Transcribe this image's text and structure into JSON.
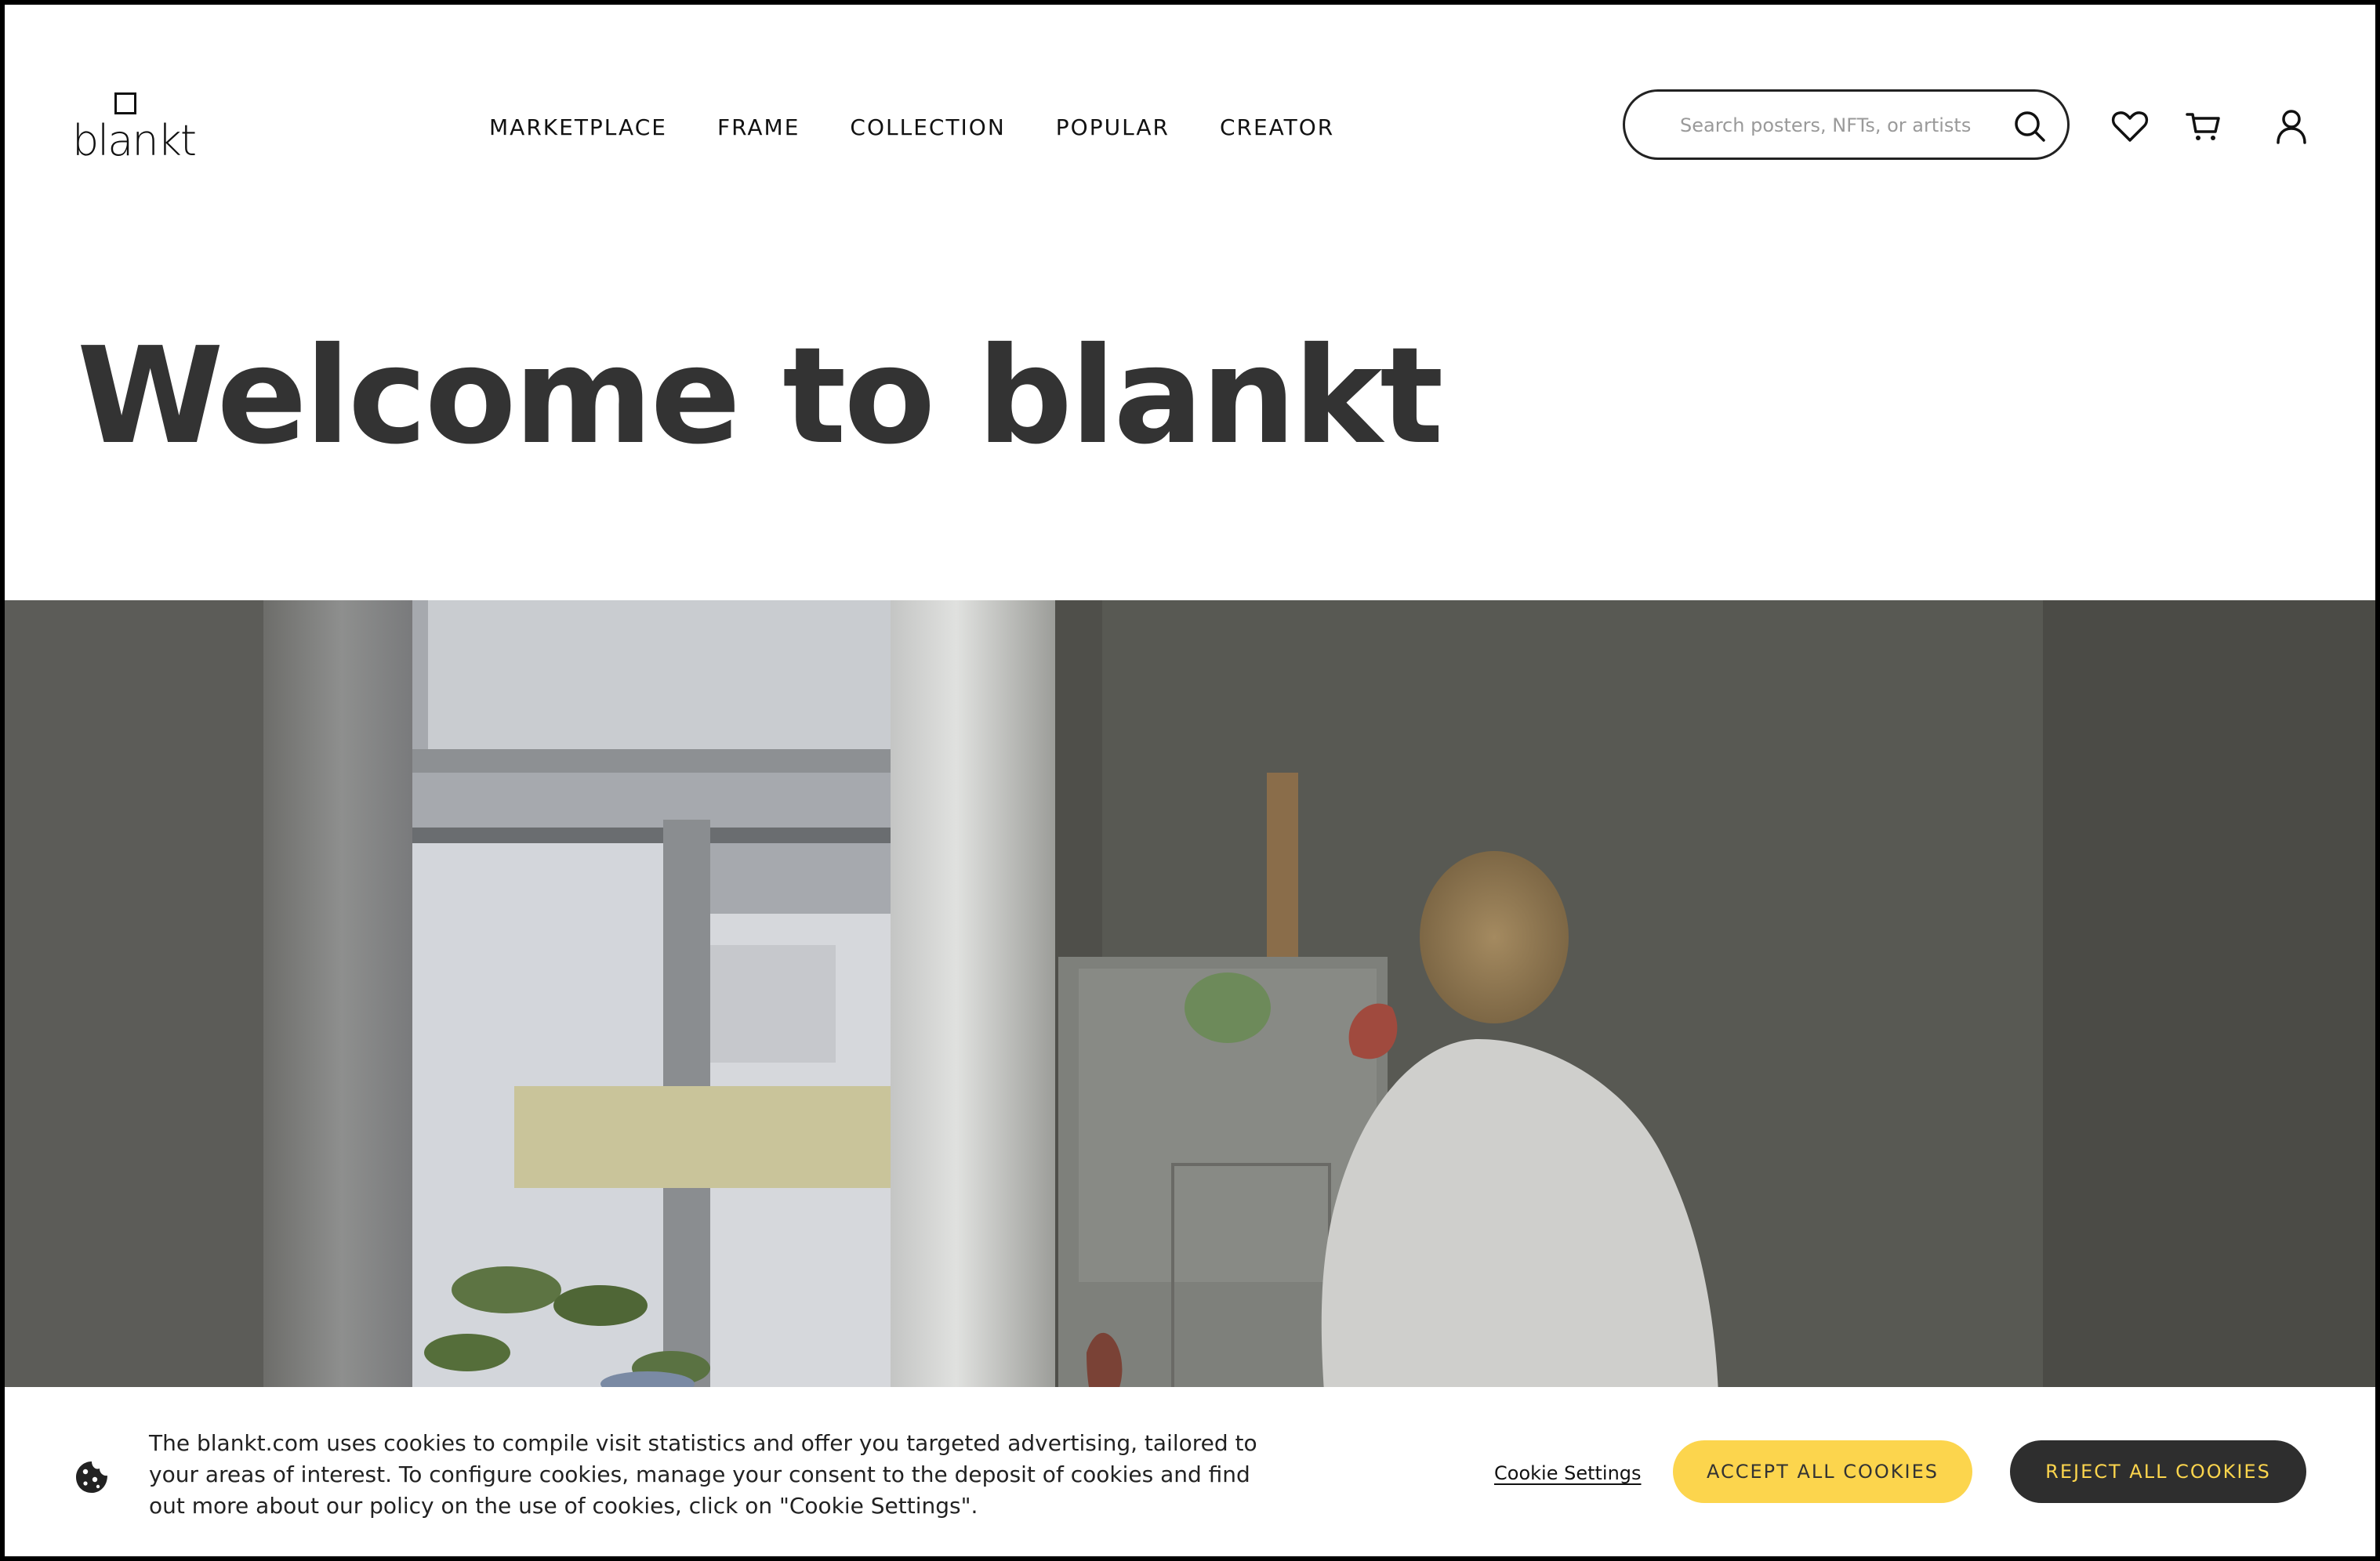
{
  "brand": {
    "logo_text": "blankt"
  },
  "nav": {
    "items": [
      {
        "label": "MARKETPLACE"
      },
      {
        "label": "FRAME"
      },
      {
        "label": "COLLECTION"
      },
      {
        "label": "POPULAR"
      },
      {
        "label": "CREATOR"
      }
    ]
  },
  "search": {
    "placeholder": "Search posters, NFTs, or artists"
  },
  "icons": {
    "search": "search-icon",
    "favorites": "heart-icon",
    "cart": "cart-icon",
    "account": "user-icon",
    "cookie": "cookie-icon"
  },
  "hero": {
    "title": "Welcome to blankt"
  },
  "cookie_banner": {
    "text": "The blankt.com uses cookies to compile visit statistics and offer you targeted advertising, tailored to your areas of interest. To configure cookies, manage your consent to the deposit of cookies and find out more about our policy on the use of cookies, click on \"Cookie Settings\".",
    "settings_label": "Cookie Settings",
    "accept_label": "ACCEPT ALL COOKIES",
    "reject_label": "REJECT ALL COOKIES"
  },
  "colors": {
    "accent": "#fcd54d",
    "dark": "#2e2e2e",
    "title": "#333333"
  }
}
